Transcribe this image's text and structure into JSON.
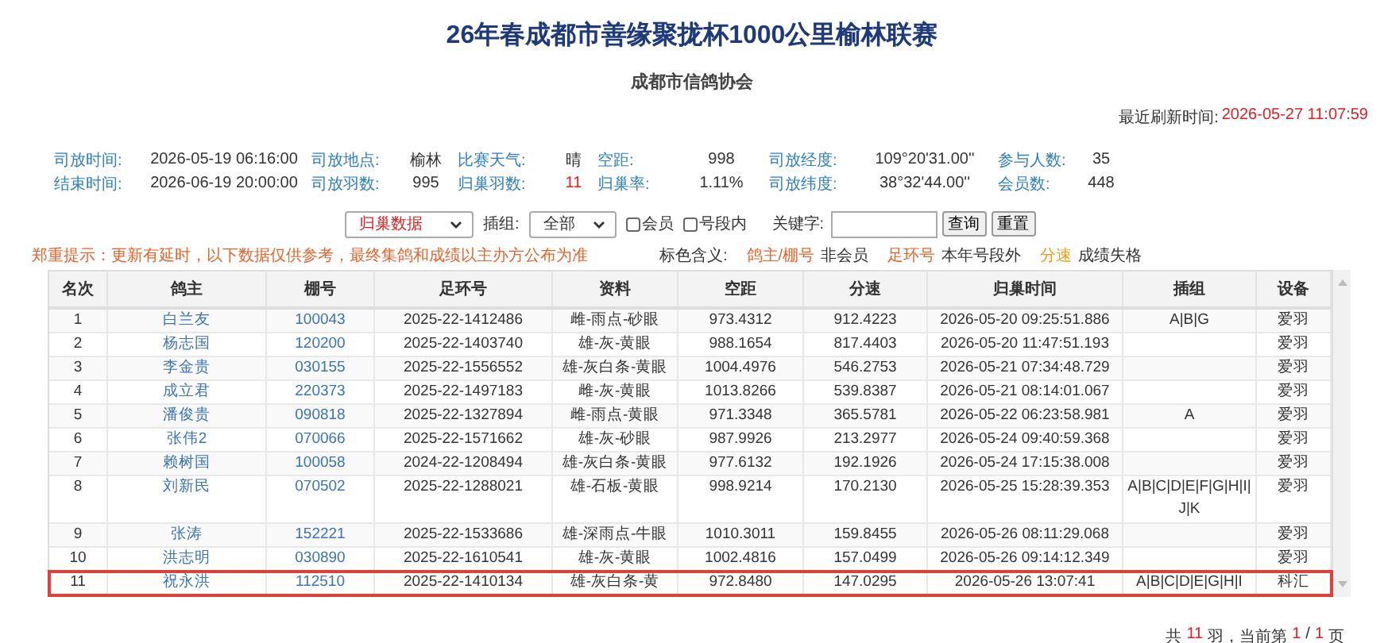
{
  "title": "26年春成都市善缘聚拢杯1000公里榆林联赛",
  "subtitle": "成都市信鸽协会",
  "refresh": {
    "label": "最近刷新时间:",
    "value": "2026-05-27 11:07:59"
  },
  "info": [
    [
      {
        "label": "司放时间:",
        "value": "2026-05-19 06:16:00",
        "highlight": false
      },
      {
        "label": "司放地点:",
        "value": "榆林",
        "highlight": false
      },
      {
        "label": "比赛天气:",
        "value": "晴",
        "highlight": false
      },
      {
        "label": "空距:",
        "value": "998",
        "highlight": false
      },
      {
        "label": "司放经度:",
        "value": "109°20'31.00''",
        "highlight": false
      },
      {
        "label": "参与人数:",
        "value": "35",
        "highlight": false
      }
    ],
    [
      {
        "label": "结束时间:",
        "value": "2026-06-19 20:00:00",
        "highlight": false
      },
      {
        "label": "司放羽数:",
        "value": "995",
        "highlight": false
      },
      {
        "label": "归巢羽数:",
        "value": "11",
        "highlight": true
      },
      {
        "label": "归巢率:",
        "value": "1.11%",
        "highlight": false
      },
      {
        "label": "司放纬度:",
        "value": "38°32'44.00''",
        "highlight": false
      },
      {
        "label": "会员数:",
        "value": "448",
        "highlight": false
      }
    ]
  ],
  "controls": {
    "data_select": "归巢数据",
    "group_label": "插组:",
    "group_select": "全部",
    "checkboxes": [
      {
        "label": "会员",
        "checked": false
      },
      {
        "label": "号段内",
        "checked": false
      }
    ],
    "keyword_label": "关键字:",
    "buttons": [
      "查询",
      "重置"
    ]
  },
  "notice": "郑重提示：更新有延时，以下数据仅供参考，最终集鸽和成绩以主办方公布为准",
  "legend": {
    "label": "标色含义:",
    "items": [
      {
        "sample": "鸽主/棚号",
        "meaning": "非会员",
        "color": "#e8632a"
      },
      {
        "sample": "足环号",
        "meaning": "本年号段外",
        "color": "#e8632a"
      },
      {
        "sample": "分速",
        "meaning": "成绩失格",
        "color": "#f39c12"
      }
    ]
  },
  "table": {
    "columns": [
      "名次",
      "鸽主",
      "棚号",
      "足环号",
      "资料",
      "空距",
      "分速",
      "归巢时间",
      "插组",
      "设备"
    ],
    "rows": [
      {
        "selected": false,
        "cells": [
          "1",
          "白兰友",
          "100043",
          "2025-22-1412486",
          "雌-雨点-砂眼",
          "973.4312",
          "912.4223",
          "2026-05-20 09:25:51.886",
          "A|B|G",
          "爱羽"
        ]
      },
      {
        "selected": false,
        "cells": [
          "2",
          "杨志国",
          "120200",
          "2025-22-1403740",
          "雄-灰-黄眼",
          "988.1654",
          "817.4403",
          "2026-05-20 11:47:51.193",
          "",
          "爱羽"
        ]
      },
      {
        "selected": false,
        "cells": [
          "3",
          "李金贵",
          "030155",
          "2025-22-1556552",
          "雄-灰白条-黄眼",
          "1004.4976",
          "546.2753",
          "2026-05-21 07:34:48.729",
          "",
          "爱羽"
        ]
      },
      {
        "selected": false,
        "cells": [
          "4",
          "成立君",
          "220373",
          "2025-22-1497183",
          "雌-灰-黄眼",
          "1013.8266",
          "539.8387",
          "2026-05-21 08:14:01.067",
          "",
          "爱羽"
        ]
      },
      {
        "selected": false,
        "cells": [
          "5",
          "潘俊贵",
          "090818",
          "2025-22-1327894",
          "雌-雨点-黄眼",
          "971.3348",
          "365.5781",
          "2026-05-22 06:23:58.981",
          "A",
          "爱羽"
        ]
      },
      {
        "selected": false,
        "cells": [
          "6",
          "张伟2",
          "070066",
          "2025-22-1571662",
          "雄-灰-砂眼",
          "987.9926",
          "213.2977",
          "2026-05-24 09:40:59.368",
          "",
          "爱羽"
        ]
      },
      {
        "selected": false,
        "cells": [
          "7",
          "赖树国",
          "100058",
          "2024-22-1208494",
          "雄-灰白条-黄眼",
          "977.6132",
          "192.1926",
          "2026-05-24 17:15:38.008",
          "",
          "爱羽"
        ]
      },
      {
        "selected": false,
        "cells": [
          "8",
          "刘新民",
          "070502",
          "2025-22-1288021",
          "雄-石板-黄眼",
          "998.9214",
          "170.2130",
          "2026-05-25 15:28:39.353",
          "A|B|C|D|E|F|G|H|I|J|K",
          "爱羽"
        ]
      },
      {
        "selected": false,
        "cells": [
          "9",
          "张涛",
          "152221",
          "2025-22-1533686",
          "雄-深雨点-牛眼",
          "1010.3011",
          "159.8455",
          "2026-05-26 08:11:29.068",
          "",
          "爱羽"
        ]
      },
      {
        "selected": false,
        "cells": [
          "10",
          "洪志明",
          "030890",
          "2025-22-1610541",
          "雄-灰-黄眼",
          "1002.4816",
          "157.0499",
          "2026-05-26 09:14:12.349",
          "",
          "爱羽"
        ]
      },
      {
        "selected": true,
        "cells": [
          "11",
          "祝永洪",
          "112510",
          "2025-22-1410134",
          "雄-灰白条-黄",
          "972.8480",
          "147.0295",
          "2026-05-26 13:07:41",
          "A|B|C|D|E|G|H|I",
          "科汇"
        ]
      }
    ]
  },
  "pagination": {
    "prefix": "共",
    "total": "11",
    "mid": "羽，当前第",
    "page": "1",
    "sep": "/",
    "pages": "1",
    "suffix": "页"
  }
}
